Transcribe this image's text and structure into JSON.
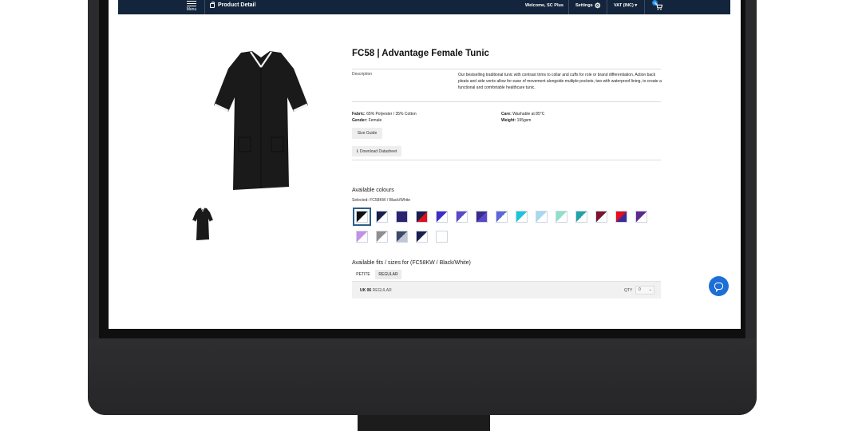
{
  "header": {
    "menu_label": "Menu",
    "page_title": "Product Detail",
    "welcome": "Welcome, SC Plus",
    "settings_label": "Settings",
    "vat_label": "VAT (INC) ▾",
    "cart_count": "0"
  },
  "product": {
    "title": "FC58 | Advantage Female Tunic",
    "description_label": "Description",
    "description": "Our bestselling traditional tunic with contrast trims to collar and cuffs for role or brand differentiation. Action back pleats and side vents allow for ease of movement alongside multiple pockets, two with waterproof lining, to create a functional and comfortable healthcare tunic.",
    "fabric_label": "Fabric:",
    "fabric": "65% Polyester / 35% Cotton",
    "gender_label": "Gender:",
    "gender": "Female",
    "care_label": "Care:",
    "care": "Washable at 85°C",
    "weight_label": "Weight:",
    "weight": "195gsm",
    "size_guide": "Size Guide",
    "download": "Download Datasheet"
  },
  "colours": {
    "heading": "Available colours",
    "selected": "Selected: FC58KW / Black/White",
    "swatches": [
      {
        "a": "#111111",
        "b": "#ffffff"
      },
      {
        "a": "#1a1f4d",
        "b": "#ffffff"
      },
      {
        "a": "#2b2470",
        "b": "#2b2470"
      },
      {
        "a": "#1a1f4d",
        "b": "#e0101e"
      },
      {
        "a": "#3e2bc9",
        "b": "#ffffff"
      },
      {
        "a": "#5a48c8",
        "b": "#ffffff"
      },
      {
        "a": "#3b2a8e",
        "b": "#5a48c8"
      },
      {
        "a": "#5c68d8",
        "b": "#ffffff"
      },
      {
        "a": "#1cc4d9",
        "b": "#ffffff"
      },
      {
        "a": "#a6d8ef",
        "b": "#ffffff"
      },
      {
        "a": "#8fe0c8",
        "b": "#ffffff"
      },
      {
        "a": "#1fa3a8",
        "b": "#ffffff"
      },
      {
        "a": "#7a1530",
        "b": "#ffffff"
      },
      {
        "a": "#e0101e",
        "b": "#3a2a9a"
      },
      {
        "a": "#5b2a8e",
        "b": "#ffffff"
      },
      {
        "a": "#c58fe8",
        "b": "#ffffff"
      },
      {
        "a": "#8f8f8f",
        "b": "#ffffff"
      },
      {
        "a": "#3b4a6b",
        "b": "#bfc6d4"
      },
      {
        "a": "#1a1f4d",
        "b": "#ffffff"
      },
      {
        "a": "#ffffff",
        "b": "#ffffff"
      }
    ]
  },
  "fits": {
    "heading": "Available fits / sizes for (FC58KW / Black/White)",
    "tabs": [
      "PETITE",
      "REGULAR"
    ],
    "row_size": "UK 06",
    "row_fit": "REGULAR",
    "qty_label": "QTY",
    "qty_value": "0"
  },
  "colors": {
    "nav_bg": "#13253c",
    "accent": "#1d6fd6"
  }
}
